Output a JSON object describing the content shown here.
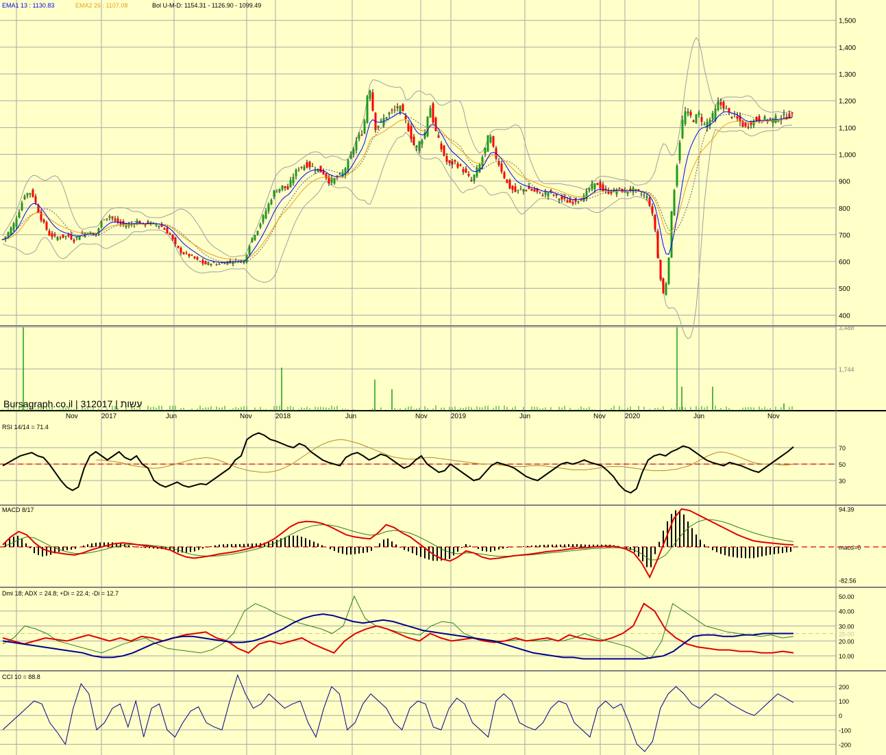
{
  "header": {
    "ema1": "EMA1 13 : 1130.83",
    "ema2": "EMA2 26 : 1107.08",
    "bol": "Bol U-M-D: 1154.31 - 1126.90 - 1099.49"
  },
  "watermark": "Bursagraph.co.il | 312017 | עשות",
  "colors": {
    "background": "#ffffc8",
    "up": "#1e9a1e",
    "down": "#ff0000",
    "ema1": "#0000ff",
    "ema2": "#e8a317",
    "bollinger": "#a0a0a0",
    "rsi": "#000000",
    "macd": "#e00000",
    "adx": "#00008b",
    "plusdi": "#2e7d1e",
    "minusdi": "#e00000",
    "cci": "#00008b",
    "volume": "#1e9a1e",
    "grid": "#a8a8a8",
    "ref_line": "#e00000"
  },
  "x_axis": {
    "labels": [
      "Nov",
      "2017",
      "Jun",
      "Nov",
      "2018",
      "Jun",
      "Nov",
      "2019",
      "Jun",
      "Nov",
      "2020",
      "Jun",
      "Nov"
    ]
  },
  "price_axis": {
    "labels": [
      "1,500",
      "1,400",
      "1,300",
      "1,200",
      "1,100",
      "1,000",
      "900",
      "800",
      "700",
      "600",
      "500",
      "400"
    ]
  },
  "volume_axis": {
    "labels": [
      "3,488",
      "1,744"
    ]
  },
  "rsi": {
    "title": "RSI 14/14 = 71.4",
    "axis_labels": [
      "70",
      "50",
      "30"
    ]
  },
  "macd": {
    "title": "MACD 8/17",
    "axis_labels": [
      "94.39",
      "macd=0",
      "-82.56"
    ]
  },
  "dmi": {
    "title": "Dmi 18; ADX = 24.8; +Di = 22.4; -Di = 12.7",
    "axis_labels": [
      "50.00",
      "40.00",
      "30.00",
      "25.00",
      "20.00",
      "10.00"
    ]
  },
  "cci": {
    "title": "CCI 10 = 88.8",
    "axis_labels": [
      "200",
      "100",
      "0",
      "-100",
      "-200"
    ]
  },
  "chart_data": {
    "type": "line",
    "price_keypoints": {
      "x": [
        0,
        10,
        20,
        28,
        36,
        46,
        60,
        72,
        80,
        100,
        108,
        116,
        128,
        140,
        150,
        160,
        168,
        176,
        184,
        192,
        200,
        208,
        216,
        222,
        228,
        234,
        240,
        248,
        256,
        262,
        268,
        274,
        282,
        290,
        300,
        308,
        316,
        326,
        332,
        340,
        348,
        356,
        366,
        376,
        388,
        400,
        412,
        420,
        428,
        436,
        448,
        460,
        472,
        480,
        490,
        500,
        510,
        520,
        528,
        534,
        538,
        542,
        548,
        556,
        566,
        574,
        582,
        590,
        598,
        606,
        616,
        622,
        626,
        634,
        644,
        654,
        664,
        676,
        688,
        700,
        708,
        714,
        722,
        732,
        742,
        752,
        762,
        772,
        782,
        792,
        802,
        812,
        822,
        832,
        842,
        852,
        862,
        872,
        882,
        892,
        902,
        912,
        922,
        930,
        938,
        944,
        950,
        956,
        962,
        968,
        972,
        976,
        980,
        986,
        992,
        998,
        1004,
        1012,
        1020,
        1028,
        1036,
        1042,
        1048,
        1056,
        1064,
        1072,
        1080,
        1088,
        1096,
        1104,
        1112,
        1120,
        1128,
        1136,
        1144,
        1152,
        1158
      ],
      "y": [
        670,
        700,
        740,
        790,
        850,
        860,
        760,
        700,
        690,
        695,
        680,
        700,
        710,
        700,
        760,
        770,
        750,
        740,
        735,
        740,
        750,
        735,
        745,
        740,
        740,
        735,
        720,
        700,
        660,
        640,
        630,
        625,
        615,
        600,
        590,
        595,
        590,
        595,
        600,
        600,
        605,
        600,
        680,
        720,
        790,
        860,
        880,
        870,
        920,
        950,
        960,
        950,
        930,
        900,
        910,
        930,
        980,
        1050,
        1080,
        1150,
        1290,
        1200,
        1100,
        1120,
        1150,
        1160,
        1180,
        1140,
        1080,
        1020,
        1060,
        1090,
        1200,
        1100,
        1020,
        960,
        970,
        940,
        900,
        960,
        1020,
        1080,
        1000,
        940,
        880,
        860,
        870,
        870,
        860,
        850,
        860,
        840,
        830,
        820,
        830,
        840,
        880,
        890,
        860,
        860,
        870,
        860,
        870,
        860,
        850,
        840,
        800,
        720,
        560,
        480,
        520,
        620,
        780,
        920,
        1050,
        1160,
        1150,
        1130,
        1150,
        1110,
        1130,
        1150,
        1190,
        1180,
        1150,
        1140,
        1120,
        1100,
        1120,
        1130,
        1130,
        1130,
        1130,
        1135,
        1140,
        1145,
        1140
      ]
    },
    "volume_spikes": [
      [
        34,
        3488
      ],
      [
        411,
        1800
      ],
      [
        547,
        1300
      ],
      [
        572,
        900
      ],
      [
        988,
        3488
      ],
      [
        995,
        1000
      ],
      [
        1040,
        1000
      ],
      [
        1144,
        300
      ]
    ],
    "rsi_values": [
      48,
      52,
      56,
      60,
      62,
      64,
      60,
      58,
      50,
      40,
      30,
      22,
      18,
      22,
      45,
      60,
      65,
      60,
      55,
      60,
      65,
      58,
      55,
      60,
      50,
      45,
      30,
      25,
      22,
      25,
      28,
      24,
      22,
      24,
      26,
      25,
      30,
      35,
      40,
      45,
      55,
      60,
      80,
      85,
      88,
      85,
      80,
      78,
      75,
      72,
      70,
      75,
      72,
      65,
      60,
      55,
      52,
      50,
      48,
      58,
      62,
      64,
      60,
      55,
      58,
      62,
      60,
      55,
      50,
      45,
      48,
      55,
      60,
      50,
      45,
      40,
      42,
      50,
      45,
      40,
      35,
      30,
      32,
      40,
      48,
      52,
      50,
      48,
      45,
      40,
      35,
      32,
      30,
      35,
      40,
      45,
      50,
      52,
      50,
      52,
      55,
      52,
      50,
      48,
      42,
      35,
      25,
      18,
      15,
      20,
      40,
      55,
      60,
      62,
      60,
      65,
      68,
      72,
      70,
      65,
      60,
      55,
      52,
      50,
      48,
      52,
      50,
      48,
      45,
      42,
      40,
      45,
      50,
      55,
      60,
      65,
      71
    ],
    "rsi_signal": [
      55,
      55,
      54,
      53,
      52,
      50,
      48,
      47,
      46,
      45,
      45,
      46,
      48,
      50,
      52,
      54,
      56,
      57,
      58,
      57,
      55,
      52,
      49,
      46,
      44,
      42,
      41,
      40,
      40,
      41,
      43,
      46,
      50,
      55,
      60,
      65,
      70,
      74,
      77,
      79,
      80,
      79,
      77,
      75,
      72,
      69,
      66,
      63,
      60,
      58,
      57,
      56,
      56,
      57,
      58,
      58,
      57,
      56,
      55,
      54,
      53,
      52,
      51,
      50,
      50,
      50,
      49,
      48,
      47,
      47,
      47,
      48,
      48,
      48,
      47,
      46,
      45,
      44,
      43,
      43,
      43,
      44,
      45,
      46,
      47,
      47,
      47,
      46,
      45,
      44,
      43,
      42,
      42,
      42,
      43,
      44,
      46,
      48,
      52,
      56,
      60,
      63,
      65,
      64,
      62,
      59,
      56,
      53,
      51,
      50,
      50,
      50,
      49,
      49,
      50
    ],
    "macd_values": [
      5,
      25,
      38,
      30,
      10,
      -5,
      -12,
      -15,
      -18,
      -20,
      -15,
      -8,
      -2,
      3,
      8,
      10,
      8,
      5,
      3,
      0,
      -3,
      -8,
      -18,
      -25,
      -28,
      -25,
      -22,
      -18,
      -15,
      -12,
      -8,
      -3,
      2,
      10,
      20,
      35,
      50,
      60,
      63,
      62,
      58,
      50,
      40,
      30,
      25,
      22,
      20,
      35,
      55,
      48,
      35,
      25,
      10,
      -5,
      -20,
      -30,
      -35,
      -25,
      -10,
      -15,
      -25,
      -30,
      -28,
      -25,
      -22,
      -20,
      -18,
      -15,
      -12,
      -10,
      -8,
      -5,
      -3,
      -2,
      0,
      1,
      2,
      0,
      -5,
      -15,
      -40,
      -75,
      -30,
      20,
      70,
      94,
      90,
      80,
      70,
      60,
      50,
      40,
      30,
      22,
      15,
      12,
      10,
      8,
      6,
      5
    ],
    "macd_signal": [
      0,
      8,
      18,
      25,
      22,
      12,
      2,
      -6,
      -12,
      -16,
      -17,
      -14,
      -10,
      -5,
      0,
      4,
      6,
      6,
      5,
      3,
      1,
      -2,
      -8,
      -15,
      -20,
      -22,
      -23,
      -22,
      -20,
      -17,
      -13,
      -9,
      -4,
      2,
      9,
      19,
      30,
      40,
      48,
      53,
      55,
      54,
      50,
      44,
      38,
      33,
      29,
      31,
      38,
      41,
      39,
      34,
      26,
      16,
      5,
      -6,
      -14,
      -17,
      -15,
      -15,
      -18,
      -21,
      -23,
      -23,
      -22,
      -21,
      -20,
      -18,
      -16,
      -14,
      -12,
      -10,
      -8,
      -6,
      -4,
      -3,
      -2,
      -2,
      -3,
      -7,
      -17,
      -32,
      -32,
      -20,
      5,
      30,
      50,
      62,
      68,
      67,
      63,
      57,
      49,
      42,
      35,
      29,
      24,
      20,
      16,
      13
    ],
    "adx_values": [
      20,
      19,
      18,
      17,
      16,
      15,
      14,
      13,
      12,
      10,
      9,
      9,
      10,
      12,
      15,
      18,
      20,
      22,
      23,
      23,
      22,
      21,
      20,
      19,
      19,
      20,
      22,
      25,
      28,
      32,
      35,
      37,
      38,
      37,
      35,
      33,
      32,
      33,
      34,
      33,
      31,
      29,
      27,
      26,
      25,
      24,
      23,
      22,
      21,
      20,
      18,
      16,
      14,
      12,
      11,
      10,
      9,
      9,
      8,
      8,
      8,
      8,
      8,
      8,
      8,
      9,
      10,
      13,
      18,
      23,
      24,
      24,
      23,
      23,
      24,
      24,
      25,
      25,
      25,
      25
    ],
    "plusdi_values": [
      18,
      22,
      30,
      28,
      25,
      20,
      18,
      16,
      14,
      12,
      15,
      18,
      20,
      22,
      18,
      15,
      14,
      13,
      12,
      14,
      18,
      25,
      40,
      45,
      42,
      38,
      35,
      32,
      30,
      28,
      25,
      30,
      50,
      35,
      30,
      28,
      26,
      25,
      24,
      30,
      33,
      32,
      25,
      22,
      21,
      20,
      20,
      21,
      20,
      20,
      21,
      20,
      22,
      25,
      22,
      20,
      18,
      16,
      12,
      8,
      20,
      45,
      40,
      35,
      30,
      28,
      26,
      25,
      24,
      23,
      24,
      22,
      23
    ],
    "minusdi_values": [
      22,
      20,
      18,
      20,
      22,
      21,
      20,
      22,
      24,
      22,
      20,
      22,
      20,
      23,
      22,
      20,
      22,
      24,
      25,
      26,
      22,
      20,
      15,
      12,
      18,
      20,
      18,
      20,
      22,
      18,
      15,
      12,
      20,
      25,
      28,
      30,
      28,
      25,
      22,
      20,
      25,
      22,
      20,
      21,
      22,
      20,
      19,
      20,
      22,
      20,
      21,
      22,
      20,
      24,
      22,
      21,
      20,
      22,
      25,
      30,
      45,
      40,
      28,
      22,
      18,
      16,
      15,
      14,
      14,
      13,
      13,
      12,
      12,
      13,
      12
    ],
    "cci_values": [
      -100,
      -50,
      0,
      50,
      100,
      80,
      -50,
      -120,
      -200,
      50,
      220,
      150,
      -100,
      -50,
      50,
      80,
      -80,
      100,
      -150,
      50,
      80,
      -100,
      -150,
      -50,
      30,
      60,
      -50,
      -80,
      -100,
      100,
      280,
      150,
      50,
      80,
      150,
      100,
      50,
      80,
      100,
      -50,
      -150,
      50,
      200,
      150,
      -100,
      -50,
      80,
      150,
      100,
      50,
      -50,
      -100,
      50,
      100,
      80,
      -80,
      -100,
      50,
      120,
      80,
      -50,
      -100,
      -150,
      100,
      150,
      100,
      -50,
      -80,
      -100,
      -50,
      50,
      100,
      80,
      -50,
      -100,
      -150,
      50,
      100,
      50,
      80,
      -50,
      -200,
      -250,
      -180,
      50,
      150,
      200,
      150,
      80,
      50,
      100,
      150,
      120,
      80,
      50,
      20,
      0,
      50,
      100,
      150,
      120,
      89
    ]
  }
}
